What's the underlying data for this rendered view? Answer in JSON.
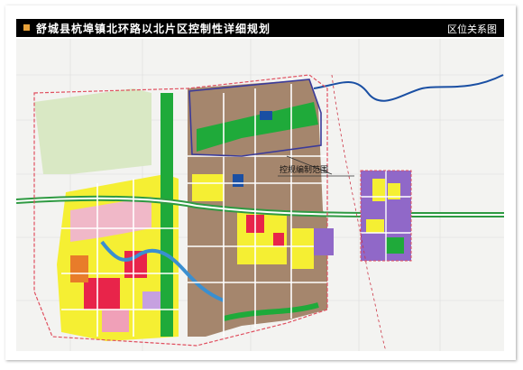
{
  "title": {
    "text": "舒城县杭埠镇北环路以北片区控制性详细规划",
    "right": "区位关系图"
  },
  "map": {
    "callout": "控规编制范围",
    "colors": {
      "residential": "#f5ef33",
      "commercial": "#e8244a",
      "industrial": "#a5866d",
      "green": "#1faa3a",
      "purple": "#9068c8",
      "road": "#ffffff",
      "water": "#1a4fa3",
      "boundary": "#e05060",
      "outline": "#3a3a9a"
    }
  }
}
